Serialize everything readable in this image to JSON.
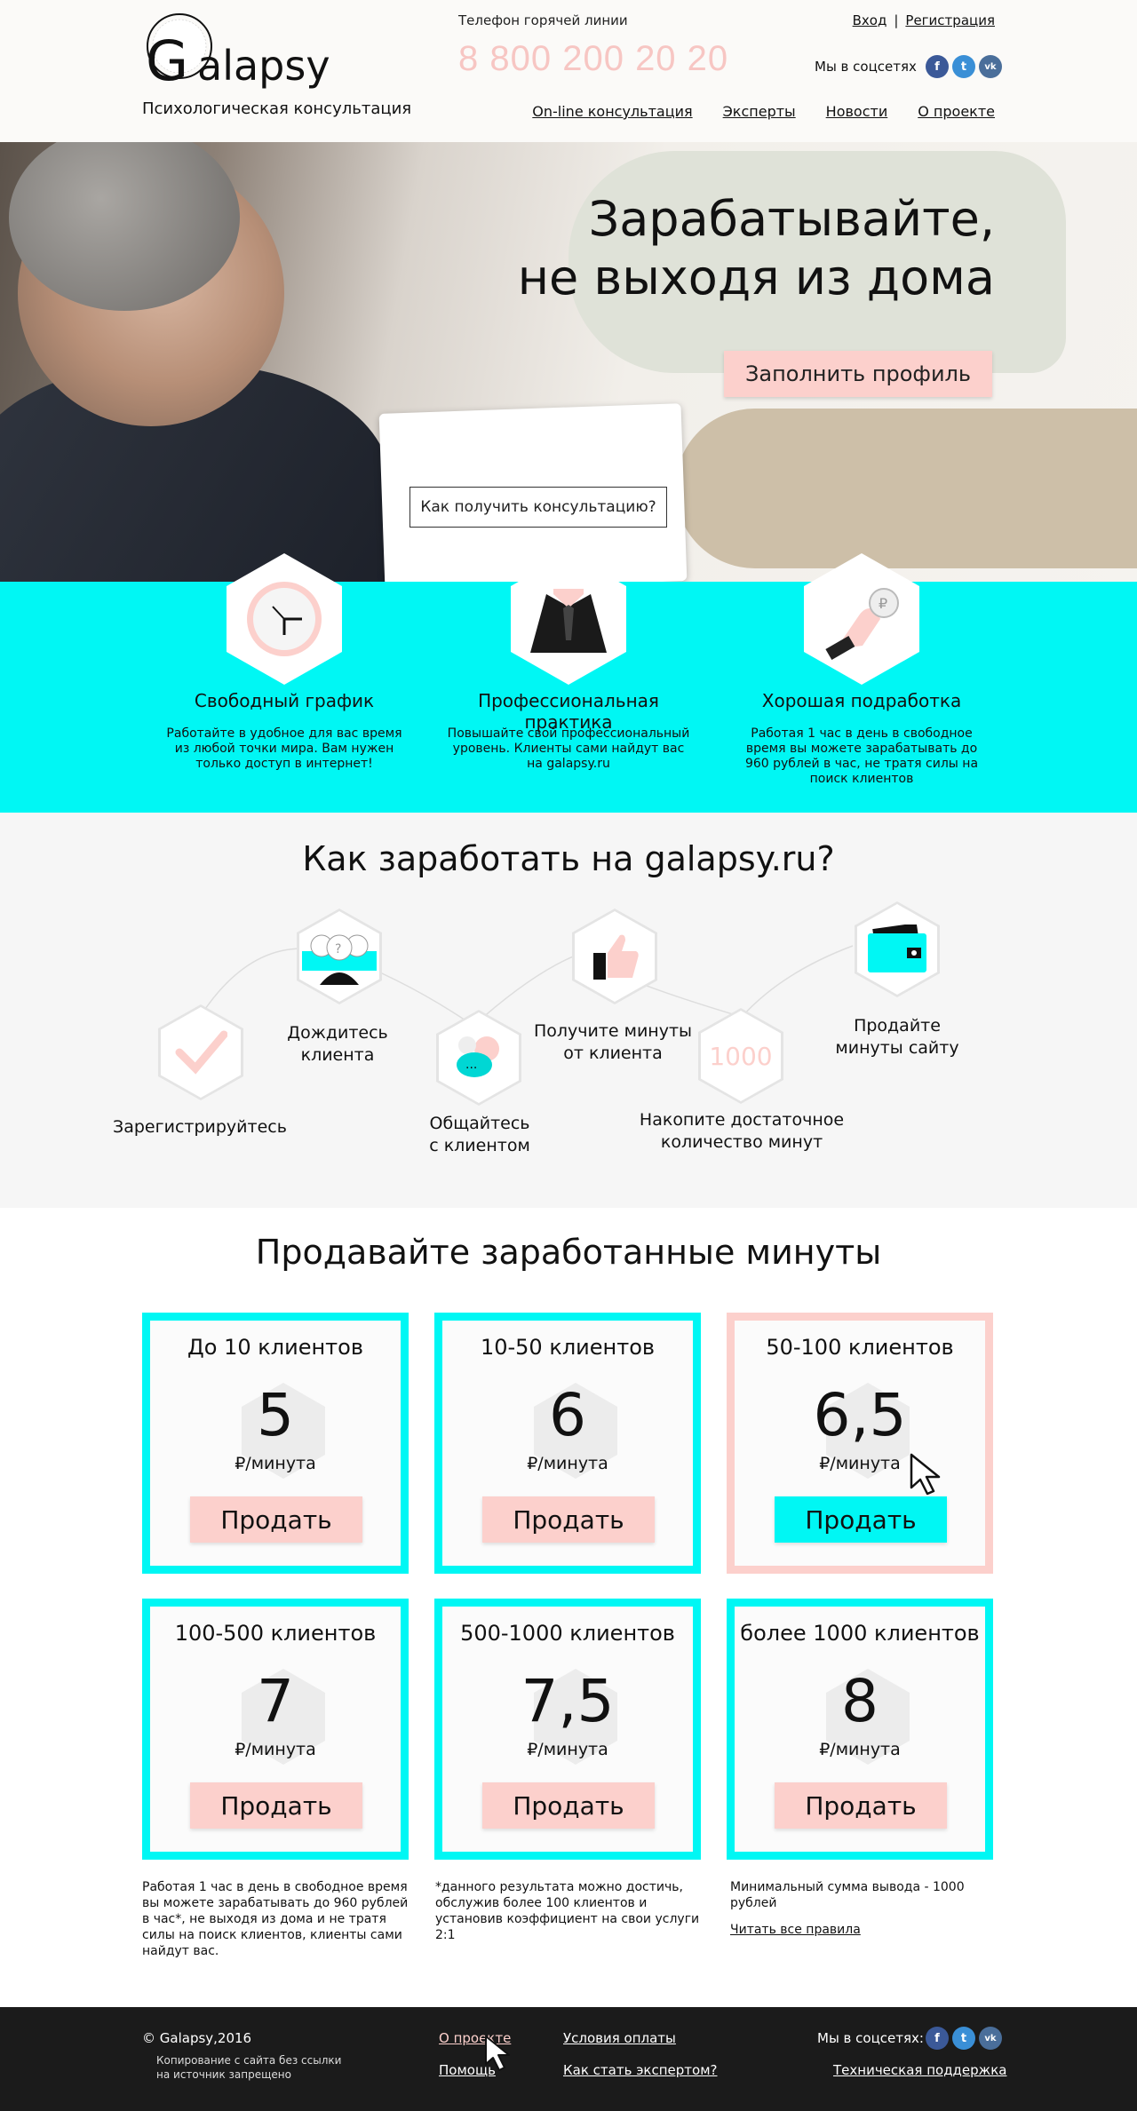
{
  "header": {
    "logo_text": "Galapsy",
    "logo_subtitle": "Психологическая консультация",
    "hotline_label": "Телефон горячей линии",
    "hotline_phone": "8 800 200 20 20",
    "login": "Вход",
    "separator": "|",
    "register": "Регистрация",
    "social_label": "Мы в соцсетях",
    "social": [
      "facebook-icon",
      "twitter-icon",
      "vk-icon"
    ],
    "nav": [
      "On-line консультация",
      "Эксперты",
      "Новости",
      "О проекте"
    ]
  },
  "hero": {
    "title_line1": "Зарабатывайте,",
    "title_line2": "не выходя из дома",
    "cta": "Заполнить профиль",
    "how": "Как получить консультацию?"
  },
  "features": [
    {
      "icon": "clock-icon",
      "title": "Свободный график",
      "text": "Работайте в удобное для вас время из любой точки мира. Вам нужен только доступ в интернет!"
    },
    {
      "icon": "suit-icon",
      "title": "Профессиональная практика",
      "text": "Повышайте свой профессиональный уровень. Клиенты сами найдут вас на galapsy.ru"
    },
    {
      "icon": "coin-hand-icon",
      "title": "Хорошая подработка",
      "text": "Работая 1 час в день в свободное время вы можете зарабатывать до 960 рублей в час, не тратя силы на поиск клиентов"
    }
  ],
  "earn": {
    "title": "Как заработать на galapsy.ru?",
    "steps": [
      {
        "icon": "checkmark-icon",
        "label": "Зарегистрируйтесь"
      },
      {
        "icon": "clients-icon",
        "label_line1": "Дождитесь",
        "label_line2": "клиента"
      },
      {
        "icon": "chat-icon",
        "label_line1": "Общайтесь",
        "label_line2": "с клиентом"
      },
      {
        "icon": "thumbs-up-icon",
        "label_line1": "Получите минуты",
        "label_line2": "от клиента"
      },
      {
        "icon": "counter-icon",
        "icon_text": "1000",
        "label_line1": "Накопите достаточное",
        "label_line2": "количество минут"
      },
      {
        "icon": "wallet-icon",
        "label_line1": "Продайте",
        "label_line2": "минуты сайту"
      }
    ]
  },
  "sell": {
    "title": "Продавайте заработанные минуты",
    "unit": "₽/минута",
    "button": "Продать",
    "cards": [
      {
        "title": "До 10 клиентов",
        "value": "5"
      },
      {
        "title": "10-50 клиентов",
        "value": "6"
      },
      {
        "title": "50-100 клиентов",
        "value": "6,5"
      },
      {
        "title": "100-500 клиентов",
        "value": "7"
      },
      {
        "title": "500-1000 клиентов",
        "value": "7,5"
      },
      {
        "title": "более 1000 клиентов",
        "value": "8"
      }
    ],
    "notes": [
      "Работая 1 час в день в свободное время вы можете зарабатывать до 960 рублей в час*, не выходя из дома и не тратя силы на поиск клиентов, клиенты сами найдут вас.",
      "*данного результата можно достичь, обслужив более 100 клиентов и установив коэффициент на свои услуги 2:1",
      "Минимальный сумма вывода - 1000 рублей"
    ],
    "rules_link": "Читать все правила"
  },
  "footer": {
    "copyright": "© Galapsy,2016",
    "copy_note_line1": "Копирование с сайта без ссылки",
    "copy_note_line2": "на источник запрещено",
    "about": "О проекте",
    "help": "Помощь",
    "payment": "Условия оплаты",
    "become_expert": "Как стать экспертом?",
    "social_label": "Мы в соцсетях:",
    "support": "Техническая поддержка"
  },
  "colors": {
    "accent_cyan": "#00f7f4",
    "accent_pink": "#fcd0cc",
    "phone_pink": "#f7c6c3",
    "footer_bg": "#1b1b1b"
  }
}
